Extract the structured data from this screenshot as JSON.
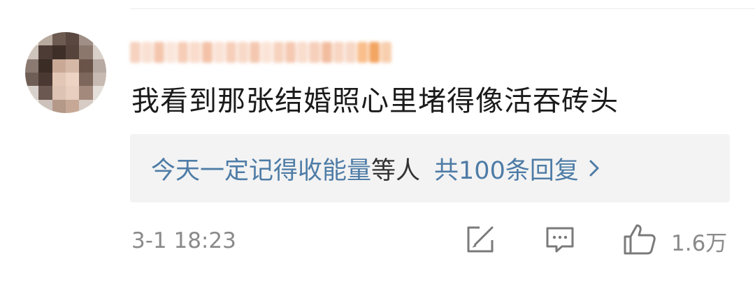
{
  "comment": {
    "author": {
      "name_hidden": true
    },
    "text": "我看到那张结婚照心里堵得像活吞砖头",
    "reply_preview": {
      "users": "今天一定记得收能量",
      "etc": "等人",
      "count_label": "共100条回复",
      "chevron": "chevron-right-icon"
    },
    "timestamp": "3-1 18:23",
    "actions": {
      "share_icon": "share-edit-icon",
      "comment_icon": "comment-bubble-icon",
      "like_icon": "thumbs-up-icon",
      "like_count": "1.6万"
    }
  },
  "colors": {
    "link_blue": "#4e7ca6",
    "text_main": "#1a1a1a",
    "text_muted": "#8a8a8a",
    "reply_bg": "#f3f3f3",
    "icon_gray": "#7a7a7a"
  }
}
